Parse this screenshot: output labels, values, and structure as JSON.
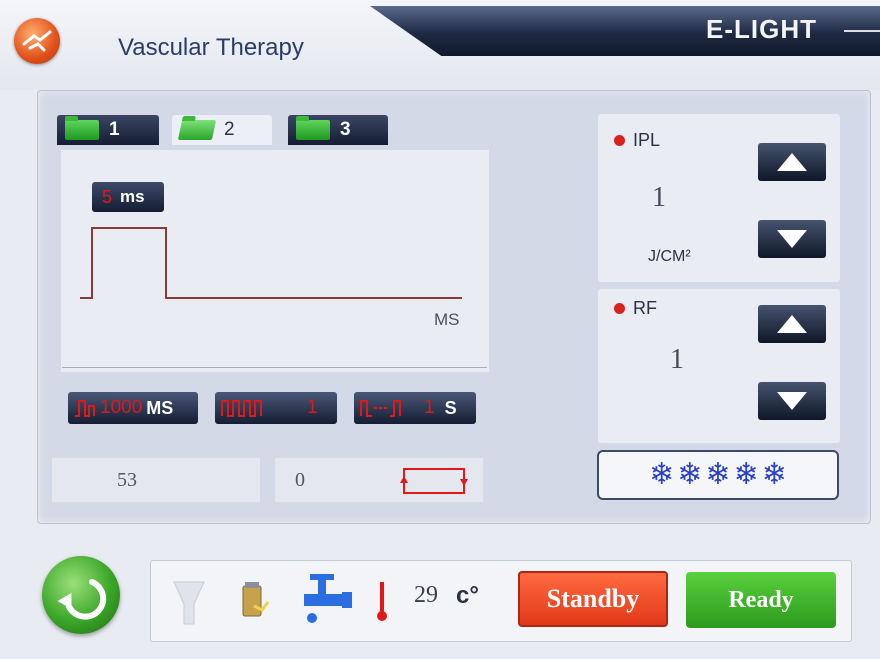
{
  "header": {
    "title": "Vascular Therapy",
    "brand": "E-LIGHT"
  },
  "tabs": [
    {
      "label": "1",
      "icon": "folder-icon",
      "active": false
    },
    {
      "label": "2",
      "icon": "folder-open-icon",
      "active": true
    },
    {
      "label": "3",
      "icon": "folder-icon",
      "active": false
    }
  ],
  "pulse": {
    "width_value": "5",
    "width_unit": "ms",
    "axis_label": "MS"
  },
  "params": {
    "interval_value": "1000",
    "interval_unit": "MS",
    "count_value": "1",
    "delay_value": "1",
    "delay_unit": "S"
  },
  "counters": {
    "shots": "53",
    "second": "0"
  },
  "ipl": {
    "label": "IPL",
    "value": "1",
    "unit": "J/CM²"
  },
  "rf": {
    "label": "RF",
    "value": "1"
  },
  "cooling": {
    "level": 5,
    "max": 5,
    "icon": "snowflake-icon"
  },
  "status": {
    "temperature": "29",
    "temp_unit": "c°",
    "standby_label": "Standby",
    "ready_label": "Ready"
  },
  "colors": {
    "accent_red": "#e01818",
    "standby": "#ef4a2a",
    "ready": "#3cb82a",
    "dark_button": "#141d32"
  }
}
